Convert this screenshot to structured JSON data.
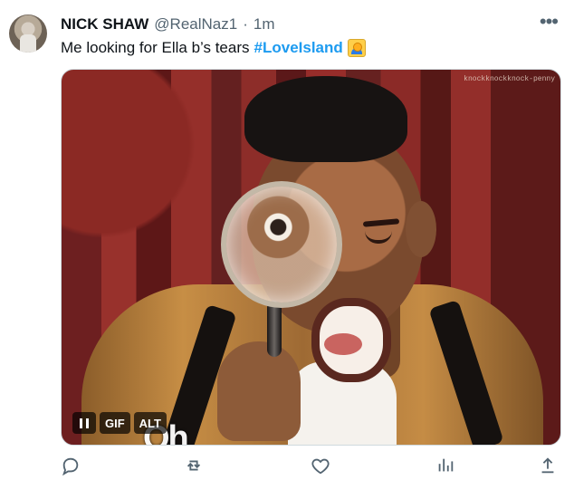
{
  "tweet": {
    "display_name": "NICK SHAW",
    "handle": "@RealNaz1",
    "separator": "·",
    "time": "1m",
    "text": "Me looking for Ella b’s tears",
    "hashtag": "#LoveIsland",
    "more_label": "•••"
  },
  "media": {
    "watermark": "knockknockknock-penny",
    "controls": [
      "II",
      "GIF",
      "ALT"
    ],
    "caption": "Oh"
  },
  "actions": {
    "icons": [
      "reply-icon",
      "retweet-icon",
      "like-icon",
      "views-icon",
      "share-icon"
    ]
  }
}
